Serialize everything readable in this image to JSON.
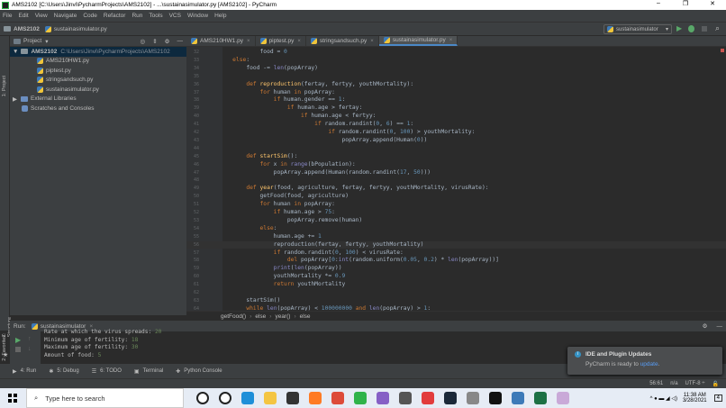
{
  "window": {
    "title": "AMS2102 [C:\\Users\\Jinvi\\PycharmProjects\\AMS2102] - ...\\sustainasimulator.py [AMS2102] - PyCharm",
    "minimize": "–",
    "maximize": "❐",
    "close": "✕"
  },
  "menu": [
    "File",
    "Edit",
    "View",
    "Navigate",
    "Code",
    "Refactor",
    "Run",
    "Tools",
    "VCS",
    "Window",
    "Help"
  ],
  "nav": {
    "project": "AMS2102",
    "file": "sustainasimulator.py",
    "run_config": "sustainasimulator"
  },
  "side_labels": {
    "project": "1: Project",
    "structure": "Z: Structure",
    "favorites": "2: Favorites"
  },
  "project_panel": {
    "title": "Project",
    "root": {
      "name": "AMS2102",
      "path": "C:\\Users\\Jinvi\\PycharmProjects\\AMS2102"
    },
    "files": [
      "AMS210HW1.py",
      "piptest.py",
      "stringsandsuch.py",
      "sustainasimulator.py"
    ],
    "external": "External Libraries",
    "scratches": "Scratches and Consoles"
  },
  "tabs": [
    {
      "label": "AMS210HW1.py",
      "active": false
    },
    {
      "label": "piptest.py",
      "active": false
    },
    {
      "label": "stringsandsuch.py",
      "active": false
    },
    {
      "label": "sustainasimulator.py",
      "active": true
    }
  ],
  "code": [
    {
      "n": "32",
      "t": "            food = 0"
    },
    {
      "n": "33",
      "t": "    else:"
    },
    {
      "n": "34",
      "t": "        food -= len(popArray)"
    },
    {
      "n": "35",
      "t": ""
    },
    {
      "n": "36",
      "t": "        def reproduction(fertay, fertyy, youthMortality):"
    },
    {
      "n": "37",
      "t": "            for human in popArray:"
    },
    {
      "n": "38",
      "t": "                if human.gender == 1:"
    },
    {
      "n": "39",
      "t": "                    if human.age > fertay:"
    },
    {
      "n": "40",
      "t": "                        if human.age < fertyy:"
    },
    {
      "n": "41",
      "t": "                            if random.randint(0, 6) == 1:"
    },
    {
      "n": "42",
      "t": "                                if random.randint(0, 100) > youthMortality:"
    },
    {
      "n": "43",
      "t": "                                    popArray.append(Human(0))"
    },
    {
      "n": "44",
      "t": ""
    },
    {
      "n": "45",
      "t": "        def startSim():"
    },
    {
      "n": "46",
      "t": "            for x in range(bPopulation):"
    },
    {
      "n": "47",
      "t": "                popArray.append(Human(random.randint(17, 50)))"
    },
    {
      "n": "48",
      "t": ""
    },
    {
      "n": "49",
      "t": "        def year(food, agriculture, fertay, fertyy, youthMortality, virusRate):"
    },
    {
      "n": "50",
      "t": "            getFood(food, agriculture)"
    },
    {
      "n": "51",
      "t": "            for human in popArray:"
    },
    {
      "n": "52",
      "t": "                if human.age > 75:"
    },
    {
      "n": "53",
      "t": "                    popArray.remove(human)"
    },
    {
      "n": "54",
      "t": "            else:"
    },
    {
      "n": "55",
      "t": "                human.age += 1"
    },
    {
      "n": "56",
      "t": "                reproduction(fertay, fertyy, youthMortality)"
    },
    {
      "n": "57",
      "t": "                if random.randint(0, 100) < virusRate:"
    },
    {
      "n": "58",
      "t": "                    del popArray[0:int(random.uniform(0.05, 0.2) * len(popArray))]"
    },
    {
      "n": "59",
      "t": "                print(len(popArray))"
    },
    {
      "n": "60",
      "t": "                youthMortality *= 0.9"
    },
    {
      "n": "61",
      "t": "                return youthMortality"
    },
    {
      "n": "62",
      "t": ""
    },
    {
      "n": "63",
      "t": "        startSim()"
    },
    {
      "n": "64",
      "t": "        while len(popArray) < 100000000 and len(popArray) > 1:"
    }
  ],
  "breadcrumb": [
    "getFood()",
    "else",
    "year()",
    "else"
  ],
  "run": {
    "label": "Run:",
    "config": "sustainasimulator",
    "output": [
      {
        "text": "Rate at which the virus spreads: ",
        "value": "20"
      },
      {
        "text": "Minimum age of fertility: ",
        "value": "18"
      },
      {
        "text": "Maximum age of fertility: ",
        "value": "30"
      },
      {
        "text": "Amount of food: ",
        "value": "5"
      }
    ]
  },
  "bottom_tabs": [
    "4: Run",
    "5: Debug",
    "6: TODO",
    "Terminal",
    "Python Console"
  ],
  "notification": {
    "title": "IDE and Plugin Updates",
    "body": "PyCharm is ready to ",
    "link": "update",
    "end": "."
  },
  "status": {
    "position": "56:61",
    "sep": "n/a",
    "encoding": "UTF-8 ÷"
  },
  "taskbar": {
    "search_placeholder": "Type here to search",
    "time": "11:38 AM",
    "date": "3/28/2021",
    "notifications": "4"
  },
  "colors": {
    "accent": "#4a88c7",
    "keyword": "#cc7832",
    "number": "#6897bb",
    "function": "#ffc66d"
  }
}
